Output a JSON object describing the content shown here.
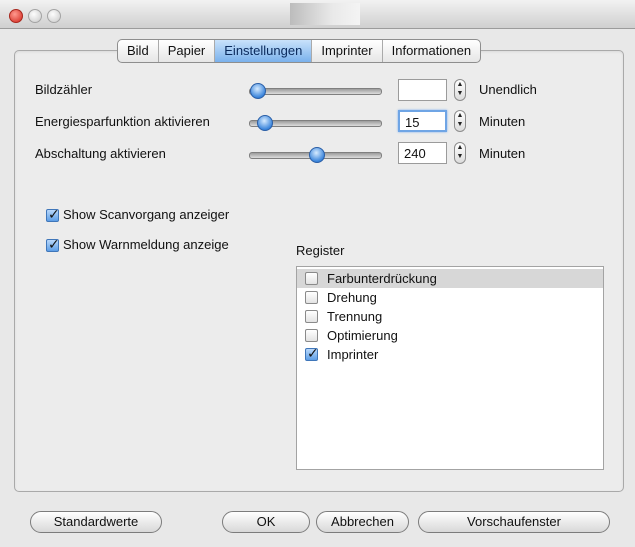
{
  "tabs": [
    "Bild",
    "Papier",
    "Einstellungen",
    "Imprinter",
    "Informationen"
  ],
  "active_tab": "Einstellungen",
  "settings": {
    "bildzaehler": {
      "label": "Bildzähler",
      "value": "",
      "unit": "Unendlich",
      "slider_fraction": 0.0
    },
    "energie": {
      "label": "Energiesparfunktion aktivieren",
      "value": "15",
      "unit": "Minuten",
      "slider_fraction": 0.1
    },
    "abschaltung": {
      "label": "Abschaltung aktivieren",
      "value": "240",
      "unit": "Minuten",
      "slider_fraction": 0.5
    }
  },
  "checks": {
    "scanvorgang": {
      "label": "Show Scanvorgang anzeiger",
      "checked": true
    },
    "warnmeldung": {
      "label": "Show Warnmeldung anzeige",
      "checked": true
    }
  },
  "register": {
    "title": "Register",
    "items": [
      {
        "label": "Farbunterdrückung",
        "checked": false,
        "selected": true
      },
      {
        "label": "Drehung",
        "checked": false,
        "selected": false
      },
      {
        "label": "Trennung",
        "checked": false,
        "selected": false
      },
      {
        "label": "Optimierung",
        "checked": false,
        "selected": false
      },
      {
        "label": "Imprinter",
        "checked": true,
        "selected": false
      }
    ]
  },
  "buttons": {
    "standard": "Standardwerte",
    "ok": "OK",
    "cancel": "Abbrechen",
    "preview": "Vorschaufenster"
  },
  "icons": {
    "stepper": "stepper-up-down-icon",
    "check": "checkmark-icon"
  },
  "colors": {
    "accent": "#6fa5e5",
    "tab_active": "#7ab1ec"
  }
}
